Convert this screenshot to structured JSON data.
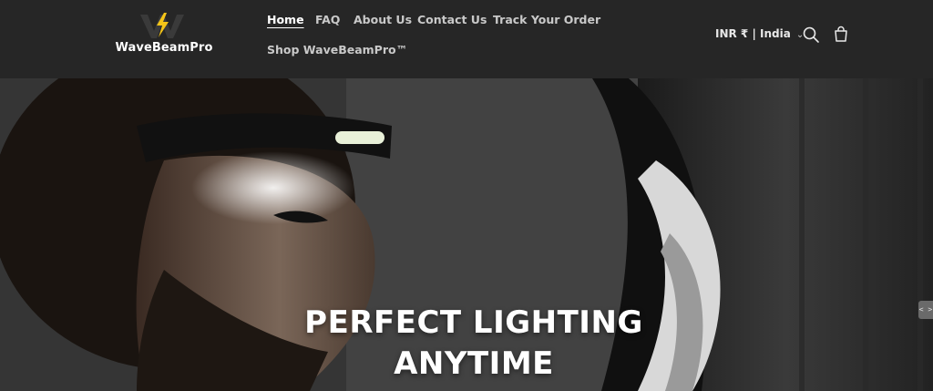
{
  "header": {
    "logo_text": "WaveBeamPro",
    "nav": [
      {
        "label": "Home",
        "active": true
      },
      {
        "label": "FAQ",
        "active": false
      },
      {
        "label": "About Us",
        "active": false
      },
      {
        "label": "Contact Us",
        "active": false
      },
      {
        "label": "Track Your Order",
        "active": false
      },
      {
        "label": "Shop WaveBeamPro™",
        "active": false
      }
    ],
    "locale": "INR ₹ | India",
    "icons": {
      "search": "search-icon",
      "cart": "cart-icon",
      "locale_dropdown": "chevron-down-icon"
    }
  },
  "hero": {
    "title_line1": "PERFECT LIGHTING",
    "title_line2": "ANYTIME",
    "side_handle": "<  >"
  },
  "colors": {
    "header_bg": "#262626",
    "logo_accent": "#f5c518",
    "nav_text": "#c9c9c9",
    "active_text": "#ffffff"
  }
}
